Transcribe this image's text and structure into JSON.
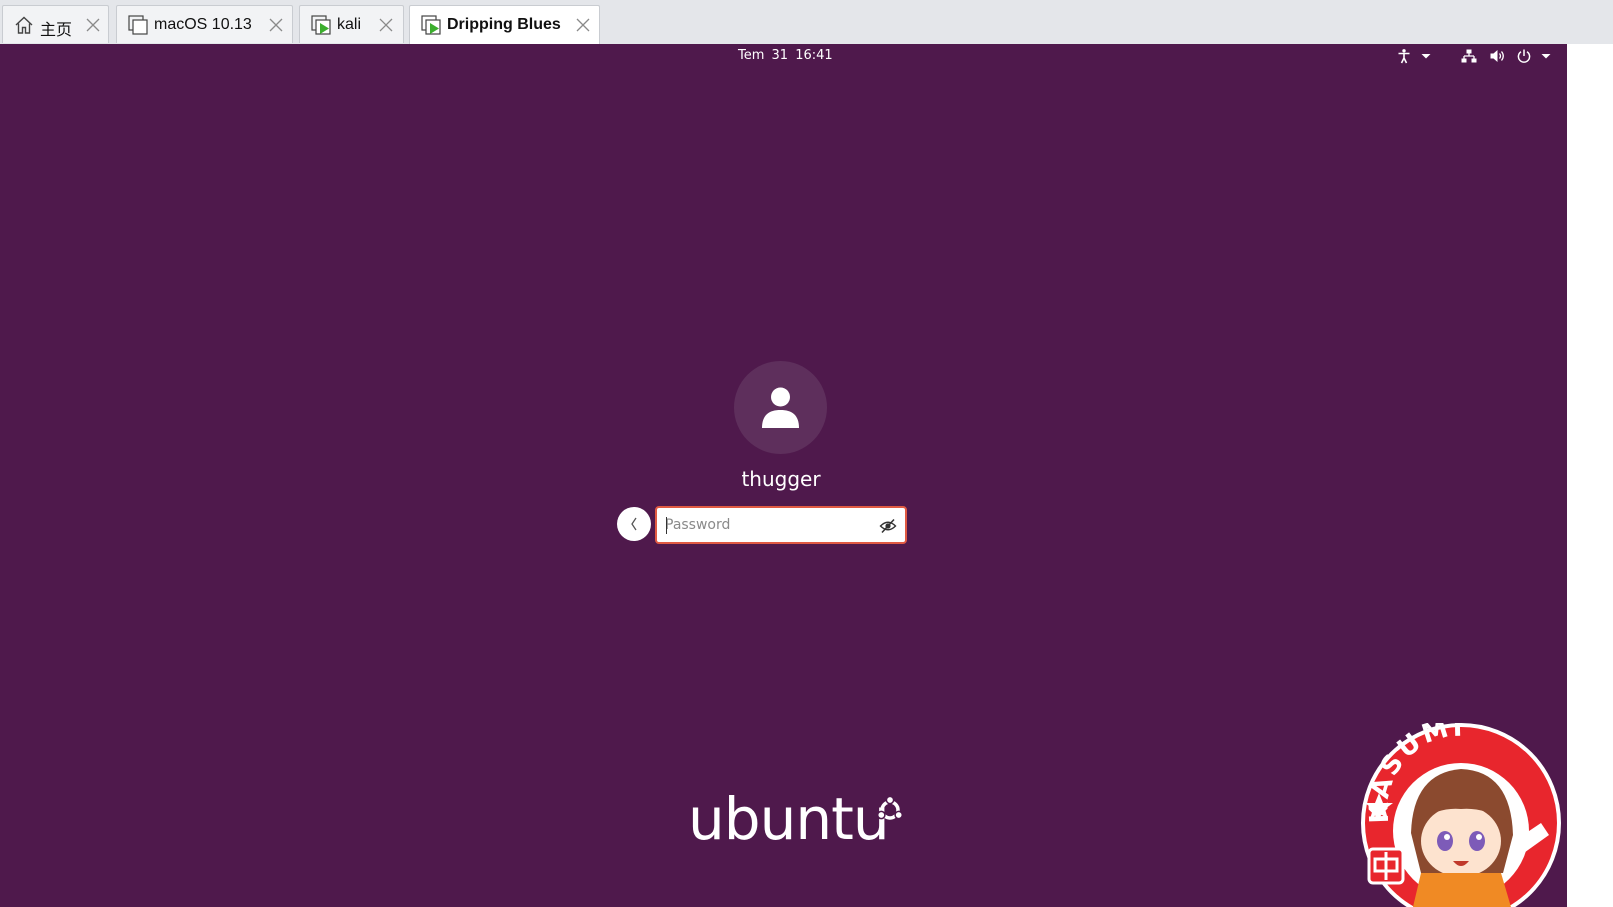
{
  "tabs": [
    {
      "label": "主页",
      "icon": "home-icon",
      "active": false
    },
    {
      "label": "macOS 10.13",
      "icon": "vm-icon",
      "active": false
    },
    {
      "label": "kali",
      "icon": "vm-running-icon",
      "active": false
    },
    {
      "label": "Dripping Blues",
      "icon": "vm-running-icon",
      "active": true
    }
  ],
  "topbar": {
    "datetime": "Tem 31  16:41",
    "indicators": [
      "accessibility-icon",
      "chevron-down-icon",
      "network-icon",
      "volume-icon",
      "power-icon",
      "chevron-down-icon"
    ]
  },
  "login": {
    "username": "thugger",
    "password_placeholder": "Password",
    "back_icon": "chevron-left-icon",
    "reveal_icon": "eye-hidden-icon"
  },
  "branding": {
    "logo_text": "ubuntu",
    "sticker_text": "KASUMI"
  },
  "colors": {
    "background": "#4f194c",
    "avatar_circle": "#5e2f5c",
    "field_border": "#e05a43",
    "tab_strip": "#e4e6ea",
    "vm_running_green": "#3cae2e"
  }
}
